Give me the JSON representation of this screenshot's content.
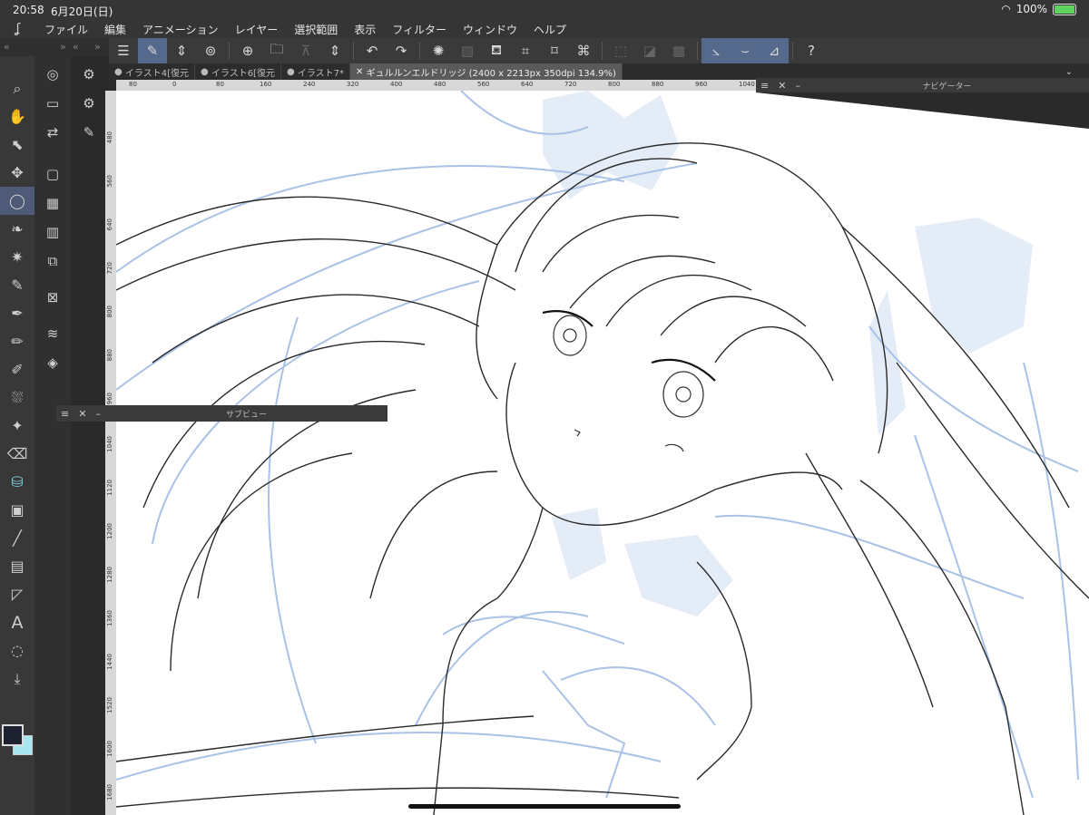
{
  "status": {
    "time": "20:58",
    "date": "6月20日(日)",
    "battery": "100%"
  },
  "menu": [
    "ファイル",
    "編集",
    "アニメーション",
    "レイヤー",
    "選択範囲",
    "表示",
    "フィルター",
    "ウィンドウ",
    "ヘルプ"
  ],
  "tabs": [
    {
      "label": "イラスト4[復元",
      "active": false
    },
    {
      "label": "イラスト6[復元",
      "active": false
    },
    {
      "label": "イラスト7*",
      "active": false
    },
    {
      "label": "ギュルルンエルドリッジ (2400 x 2213px 350dpi 134.9%)",
      "active": true
    }
  ],
  "panels": {
    "navigator": "ナビゲーター",
    "subview": "サブビュー"
  },
  "ruler_h": [
    "80",
    "0",
    "80",
    "160",
    "240",
    "320",
    "400",
    "480",
    "560",
    "640",
    "720",
    "800",
    "880",
    "960",
    "1040"
  ],
  "ruler_v": [
    "480",
    "560",
    "640",
    "720",
    "800",
    "880",
    "960",
    "1040",
    "1120",
    "1200",
    "1280",
    "1360",
    "1440",
    "1520",
    "1600",
    "1680"
  ],
  "colors": {
    "main": "#1e2130",
    "sub": "#a8e6f0",
    "accent": "#55698c"
  },
  "tools": [
    "magnifier-icon",
    "hand-icon",
    "rotate-icon",
    "move-icon",
    "lasso-icon",
    "eyedropper-drop-icon",
    "magic-wand-icon",
    "eyedropper-icon",
    "pen-icon",
    "pencil-icon",
    "brush-icon",
    "airbrush-icon",
    "sparkle-icon",
    "eraser-icon",
    "fill-icon",
    "gradient-icon",
    "line-icon",
    "frame-icon",
    "ruler-icon",
    "text-icon",
    "balloon-icon",
    "correct-line-icon"
  ]
}
